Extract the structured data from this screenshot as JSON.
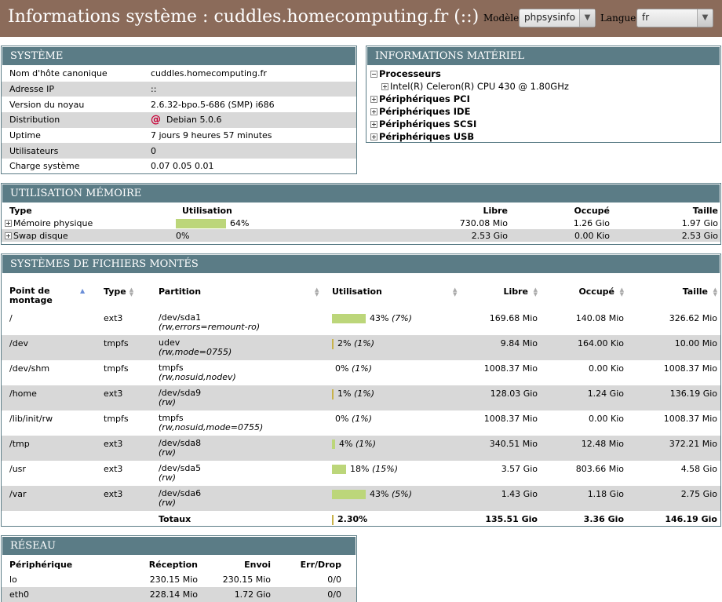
{
  "header": {
    "title": "Informations système : cuddles.homecomputing.fr (::)",
    "model_label": "Modèle",
    "model_value": "phpsysinfo",
    "lang_label": "Langue",
    "lang_value": "fr"
  },
  "system": {
    "title": "SYSTÈME",
    "rows": [
      {
        "label": "Nom d'hôte canonique",
        "value": "cuddles.homecomputing.fr"
      },
      {
        "label": "Adresse IP",
        "value": "::"
      },
      {
        "label": "Version du noyau",
        "value": "2.6.32-bpo.5-686 (SMP) i686"
      },
      {
        "label": "Distribution",
        "value": "Debian 5.0.6"
      },
      {
        "label": "Uptime",
        "value": "7 jours 9 heures 57 minutes"
      },
      {
        "label": "Utilisateurs",
        "value": "0"
      },
      {
        "label": "Charge système",
        "value": "0.07 0.05 0.01"
      }
    ]
  },
  "hardware": {
    "title": "INFORMATIONS MATÉRIEL",
    "processors": "Processeurs",
    "cpu": "Intel(R) Celeron(R) CPU 430 @ 1.80GHz",
    "pci": "Périphériques PCI",
    "ide": "Périphériques IDE",
    "scsi": "Périphériques SCSI",
    "usb": "Périphériques USB"
  },
  "memory": {
    "title": "UTILISATION MÉMOIRE",
    "headers": {
      "type": "Type",
      "usage": "Utilisation",
      "free": "Libre",
      "used": "Occupé",
      "size": "Taille"
    },
    "rows": [
      {
        "type": "Mémoire physique",
        "pct": "64%",
        "fill": 0.64,
        "free": "730.08 Mio",
        "used": "1.26 Gio",
        "size": "1.97 Gio"
      },
      {
        "type": "Swap disque",
        "pct": "0%",
        "fill": 0,
        "free": "2.53 Gio",
        "used": "0.00 Kio",
        "size": "2.53 Gio"
      }
    ]
  },
  "filesystems": {
    "title": "SYSTÈMES DE FICHIERS MONTÉS",
    "headers": {
      "mount": "Point de montage",
      "type": "Type",
      "partition": "Partition",
      "usage": "Utilisation",
      "free": "Libre",
      "used": "Occupé",
      "size": "Taille"
    },
    "rows": [
      {
        "mount": "/",
        "type": "ext3",
        "part": "/dev/sda1",
        "opts": "(rw,errors=remount-ro)",
        "pct": "43%",
        "ipct": "(7%)",
        "fill": 0.43,
        "free": "169.68 Mio",
        "used": "140.08 Mio",
        "size": "326.62 Mio"
      },
      {
        "mount": "/dev",
        "type": "tmpfs",
        "part": "udev",
        "opts": "(rw,mode=0755)",
        "pct": "2%",
        "ipct": "(1%)",
        "fill": 0.02,
        "free": "9.84 Mio",
        "used": "164.00 Kio",
        "size": "10.00 Mio"
      },
      {
        "mount": "/dev/shm",
        "type": "tmpfs",
        "part": "tmpfs",
        "opts": "(rw,nosuid,nodev)",
        "pct": "0%",
        "ipct": "(1%)",
        "fill": 0,
        "free": "1008.37 Mio",
        "used": "0.00 Kio",
        "size": "1008.37 Mio"
      },
      {
        "mount": "/home",
        "type": "ext3",
        "part": "/dev/sda9",
        "opts": "(rw)",
        "pct": "1%",
        "ipct": "(1%)",
        "fill": 0.01,
        "free": "128.03 Gio",
        "used": "1.24 Gio",
        "size": "136.19 Gio"
      },
      {
        "mount": "/lib/init/rw",
        "type": "tmpfs",
        "part": "tmpfs",
        "opts": "(rw,nosuid,mode=0755)",
        "pct": "0%",
        "ipct": "(1%)",
        "fill": 0,
        "free": "1008.37 Mio",
        "used": "0.00 Kio",
        "size": "1008.37 Mio"
      },
      {
        "mount": "/tmp",
        "type": "ext3",
        "part": "/dev/sda8",
        "opts": "(rw)",
        "pct": "4%",
        "ipct": "(1%)",
        "fill": 0.04,
        "free": "340.51 Mio",
        "used": "12.48 Mio",
        "size": "372.21 Mio"
      },
      {
        "mount": "/usr",
        "type": "ext3",
        "part": "/dev/sda5",
        "opts": "(rw)",
        "pct": "18%",
        "ipct": "(15%)",
        "fill": 0.18,
        "free": "3.57 Gio",
        "used": "803.66 Mio",
        "size": "4.58 Gio"
      },
      {
        "mount": "/var",
        "type": "ext3",
        "part": "/dev/sda6",
        "opts": "(rw)",
        "pct": "43%",
        "ipct": "(5%)",
        "fill": 0.43,
        "free": "1.43 Gio",
        "used": "1.18 Gio",
        "size": "2.75 Gio"
      }
    ],
    "totals": {
      "label": "Totaux",
      "pct": "2.30%",
      "free": "135.51 Gio",
      "used": "3.36 Gio",
      "size": "146.19 Gio"
    }
  },
  "network": {
    "title": "RÉSEAU",
    "headers": {
      "device": "Périphérique",
      "rx": "Réception",
      "tx": "Envoi",
      "err": "Err/Drop"
    },
    "rows": [
      {
        "device": "lo",
        "rx": "230.15 Mio",
        "tx": "230.15 Mio",
        "err": "0/0"
      },
      {
        "device": "eth0",
        "rx": "228.14 Mio",
        "tx": "1.72 Gio",
        "err": "0/0"
      }
    ]
  },
  "colors": {
    "header_bg": "#8b6b5a",
    "panel": "#5b7c86",
    "bar": "#bcd67a"
  }
}
